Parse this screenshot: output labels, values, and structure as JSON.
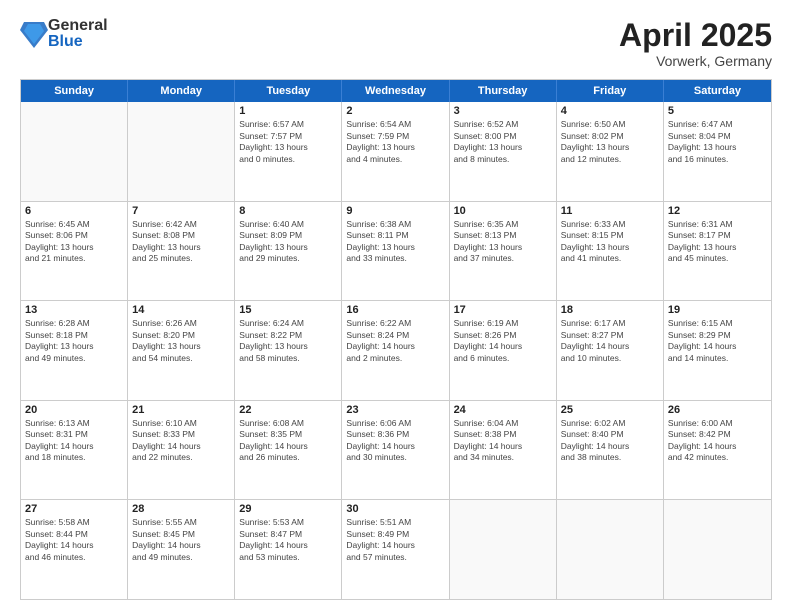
{
  "logo": {
    "general": "General",
    "blue": "Blue"
  },
  "title": {
    "month_year": "April 2025",
    "location": "Vorwerk, Germany"
  },
  "calendar": {
    "weekdays": [
      "Sunday",
      "Monday",
      "Tuesday",
      "Wednesday",
      "Thursday",
      "Friday",
      "Saturday"
    ],
    "rows": [
      [
        {
          "day": "",
          "text": ""
        },
        {
          "day": "",
          "text": ""
        },
        {
          "day": "1",
          "text": "Sunrise: 6:57 AM\nSunset: 7:57 PM\nDaylight: 13 hours\nand 0 minutes."
        },
        {
          "day": "2",
          "text": "Sunrise: 6:54 AM\nSunset: 7:59 PM\nDaylight: 13 hours\nand 4 minutes."
        },
        {
          "day": "3",
          "text": "Sunrise: 6:52 AM\nSunset: 8:00 PM\nDaylight: 13 hours\nand 8 minutes."
        },
        {
          "day": "4",
          "text": "Sunrise: 6:50 AM\nSunset: 8:02 PM\nDaylight: 13 hours\nand 12 minutes."
        },
        {
          "day": "5",
          "text": "Sunrise: 6:47 AM\nSunset: 8:04 PM\nDaylight: 13 hours\nand 16 minutes."
        }
      ],
      [
        {
          "day": "6",
          "text": "Sunrise: 6:45 AM\nSunset: 8:06 PM\nDaylight: 13 hours\nand 21 minutes."
        },
        {
          "day": "7",
          "text": "Sunrise: 6:42 AM\nSunset: 8:08 PM\nDaylight: 13 hours\nand 25 minutes."
        },
        {
          "day": "8",
          "text": "Sunrise: 6:40 AM\nSunset: 8:09 PM\nDaylight: 13 hours\nand 29 minutes."
        },
        {
          "day": "9",
          "text": "Sunrise: 6:38 AM\nSunset: 8:11 PM\nDaylight: 13 hours\nand 33 minutes."
        },
        {
          "day": "10",
          "text": "Sunrise: 6:35 AM\nSunset: 8:13 PM\nDaylight: 13 hours\nand 37 minutes."
        },
        {
          "day": "11",
          "text": "Sunrise: 6:33 AM\nSunset: 8:15 PM\nDaylight: 13 hours\nand 41 minutes."
        },
        {
          "day": "12",
          "text": "Sunrise: 6:31 AM\nSunset: 8:17 PM\nDaylight: 13 hours\nand 45 minutes."
        }
      ],
      [
        {
          "day": "13",
          "text": "Sunrise: 6:28 AM\nSunset: 8:18 PM\nDaylight: 13 hours\nand 49 minutes."
        },
        {
          "day": "14",
          "text": "Sunrise: 6:26 AM\nSunset: 8:20 PM\nDaylight: 13 hours\nand 54 minutes."
        },
        {
          "day": "15",
          "text": "Sunrise: 6:24 AM\nSunset: 8:22 PM\nDaylight: 13 hours\nand 58 minutes."
        },
        {
          "day": "16",
          "text": "Sunrise: 6:22 AM\nSunset: 8:24 PM\nDaylight: 14 hours\nand 2 minutes."
        },
        {
          "day": "17",
          "text": "Sunrise: 6:19 AM\nSunset: 8:26 PM\nDaylight: 14 hours\nand 6 minutes."
        },
        {
          "day": "18",
          "text": "Sunrise: 6:17 AM\nSunset: 8:27 PM\nDaylight: 14 hours\nand 10 minutes."
        },
        {
          "day": "19",
          "text": "Sunrise: 6:15 AM\nSunset: 8:29 PM\nDaylight: 14 hours\nand 14 minutes."
        }
      ],
      [
        {
          "day": "20",
          "text": "Sunrise: 6:13 AM\nSunset: 8:31 PM\nDaylight: 14 hours\nand 18 minutes."
        },
        {
          "day": "21",
          "text": "Sunrise: 6:10 AM\nSunset: 8:33 PM\nDaylight: 14 hours\nand 22 minutes."
        },
        {
          "day": "22",
          "text": "Sunrise: 6:08 AM\nSunset: 8:35 PM\nDaylight: 14 hours\nand 26 minutes."
        },
        {
          "day": "23",
          "text": "Sunrise: 6:06 AM\nSunset: 8:36 PM\nDaylight: 14 hours\nand 30 minutes."
        },
        {
          "day": "24",
          "text": "Sunrise: 6:04 AM\nSunset: 8:38 PM\nDaylight: 14 hours\nand 34 minutes."
        },
        {
          "day": "25",
          "text": "Sunrise: 6:02 AM\nSunset: 8:40 PM\nDaylight: 14 hours\nand 38 minutes."
        },
        {
          "day": "26",
          "text": "Sunrise: 6:00 AM\nSunset: 8:42 PM\nDaylight: 14 hours\nand 42 minutes."
        }
      ],
      [
        {
          "day": "27",
          "text": "Sunrise: 5:58 AM\nSunset: 8:44 PM\nDaylight: 14 hours\nand 46 minutes."
        },
        {
          "day": "28",
          "text": "Sunrise: 5:55 AM\nSunset: 8:45 PM\nDaylight: 14 hours\nand 49 minutes."
        },
        {
          "day": "29",
          "text": "Sunrise: 5:53 AM\nSunset: 8:47 PM\nDaylight: 14 hours\nand 53 minutes."
        },
        {
          "day": "30",
          "text": "Sunrise: 5:51 AM\nSunset: 8:49 PM\nDaylight: 14 hours\nand 57 minutes."
        },
        {
          "day": "",
          "text": ""
        },
        {
          "day": "",
          "text": ""
        },
        {
          "day": "",
          "text": ""
        }
      ]
    ]
  }
}
